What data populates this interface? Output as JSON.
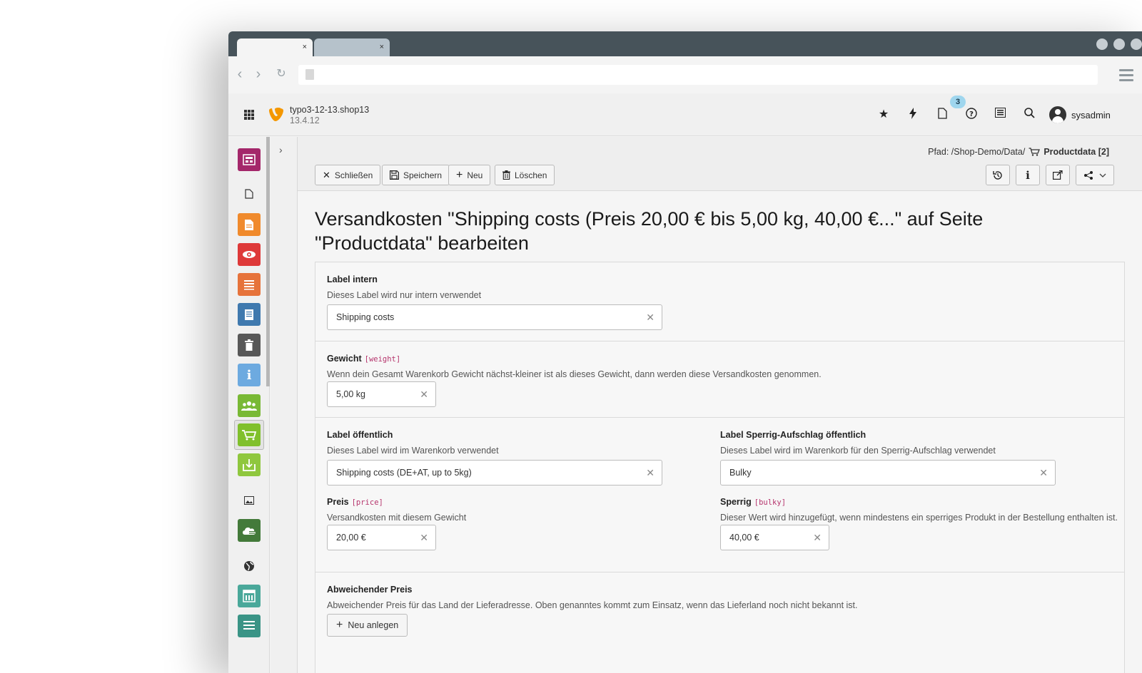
{
  "browser": {
    "tabs": [
      {
        "label": "",
        "close": "×"
      },
      {
        "label": "",
        "close": "×"
      }
    ]
  },
  "topbar": {
    "site_name": "typo3-12-13.shop13",
    "version": "13.4.12",
    "notification_count": "3",
    "username": "sysadmin"
  },
  "docheader": {
    "path_prefix": "Pfad: /Shop-Demo/Data/",
    "path_page": "Productdata [2]",
    "buttons": {
      "close": "Schließen",
      "save": "Speichern",
      "new": "Neu",
      "delete": "Löschen"
    }
  },
  "page_title": "Versandkosten \"Shipping costs (Preis 20,00 € bis 5,00 kg, 40,00 €...\" auf Seite \"Productdata\" bearbeiten",
  "form": {
    "label_intern": {
      "label": "Label intern",
      "description": "Dieses Label wird nur intern verwendet",
      "value": "Shipping costs"
    },
    "weight": {
      "label": "Gewicht",
      "key": "[weight]",
      "description": "Wenn dein Gesamt Warenkorb Gewicht nächst-kleiner ist als dieses Gewicht, dann werden diese Versandkosten genommen.",
      "value": "5,00 kg"
    },
    "label_public": {
      "label": "Label öffentlich",
      "description": "Dieses Label wird im Warenkorb verwendet",
      "value": "Shipping costs (DE+AT, up to 5kg)"
    },
    "label_bulky_public": {
      "label": "Label Sperrig-Aufschlag öffentlich",
      "description": "Dieses Label wird im Warenkorb für den Sperrig-Aufschlag verwendet",
      "value": "Bulky"
    },
    "price": {
      "label": "Preis",
      "key": "[price]",
      "description": "Versandkosten mit diesem Gewicht",
      "value": "20,00 €"
    },
    "bulky": {
      "label": "Sperrig",
      "key": "[bulky]",
      "description": "Dieser Wert wird hinzugefügt, wenn mindestens ein sperriges Produkt in der Bestellung enthalten ist.",
      "value": "40,00 €"
    },
    "deviating_price": {
      "label": "Abweichender Preis",
      "description": "Abweichender Preis für das Land der Lieferadresse. Oben genanntes kommt zum Einsatz, wenn das Lieferland noch nicht bekannt ist.",
      "button": "Neu anlegen"
    }
  },
  "module_colors": {
    "page": "#a4276a",
    "list": "#f08a2c",
    "view": "#de3939",
    "form": "#e6733b",
    "info_doc": "#3f79ae",
    "trash": "#585858",
    "info": "#6daae0",
    "users": "#79b935",
    "shop": "#80c02c",
    "import": "#8fc73e",
    "cloud": "#437a3a",
    "layout": "#4aa89a"
  }
}
